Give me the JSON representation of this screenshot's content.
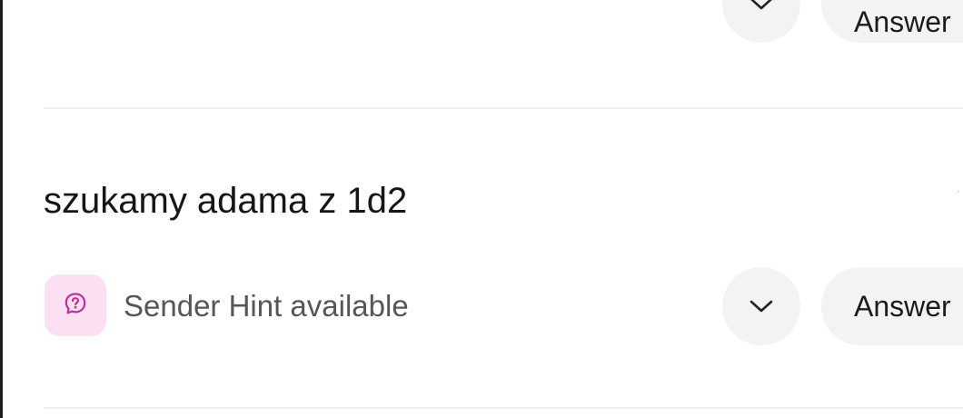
{
  "previous_item": {
    "expand_icon": "chevron-down-icon",
    "answer_label": "Answer"
  },
  "message": {
    "text": "szukamy adama z 1d2",
    "hint_icon": "question-bubble-icon",
    "hint_text": "Sender Hint available",
    "expand_icon": "chevron-down-icon",
    "answer_label": "Answer"
  },
  "colors": {
    "button_bg": "#f3f2f5",
    "hint_icon_bg": "#fbe0f4",
    "hint_icon_fg": "#c0309a",
    "hint_text": "#565656"
  }
}
